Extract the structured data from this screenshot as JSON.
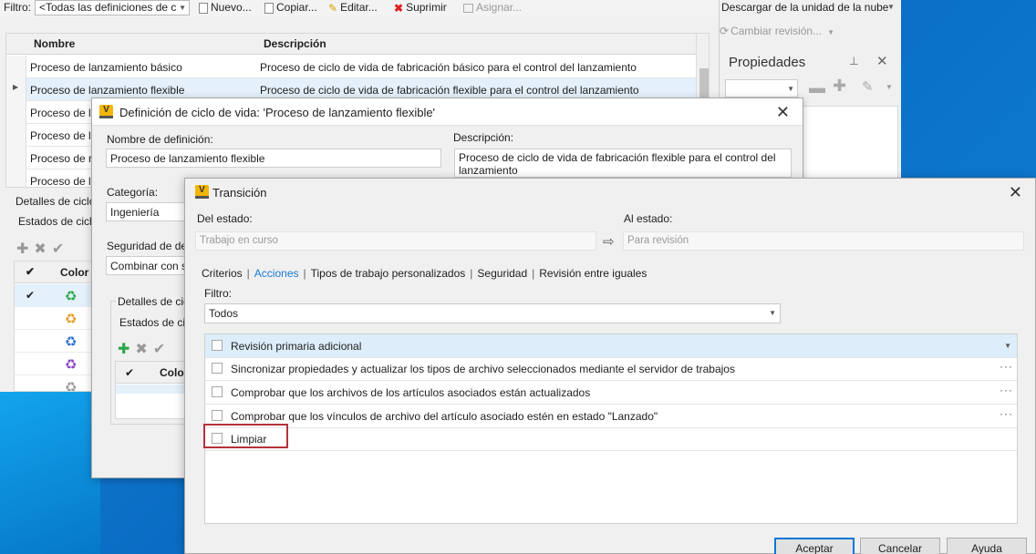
{
  "toolbar": {
    "filter_label": "Filtro:",
    "filter_value": "<Todas las definiciones de c",
    "new_label": "Nuevo...",
    "copy_label": "Copiar...",
    "edit_label": "Editar...",
    "delete_label": "Suprimir",
    "assign_label": "Asignar..."
  },
  "lifecycle_grid": {
    "columns": [
      "Nombre",
      "Descripción"
    ],
    "rows": [
      {
        "name": "Proceso de lanzamiento básico",
        "desc": "Proceso de ciclo de vida de fabricación básico para el control del lanzamiento"
      },
      {
        "name": "Proceso de lanzamiento flexible",
        "desc": "Proceso de ciclo de vida de fabricación flexible para el control del lanzamiento"
      },
      {
        "name": "Proceso de la",
        "desc": ""
      },
      {
        "name": "Proceso de la",
        "desc": ""
      },
      {
        "name": "Proceso de re",
        "desc": ""
      },
      {
        "name": "Proceso de la",
        "desc": ""
      }
    ]
  },
  "details": {
    "label": "Detalles de ciclo",
    "states_label": "Estados de ciclo",
    "col_color": "Color"
  },
  "right_panel": {
    "download_label": "Descargar de la unidad de la nube",
    "change_revision_label": "Cambiar revisión...",
    "properties_title": "Propiedades"
  },
  "dialog_lifecycle": {
    "title": "Definición de ciclo de vida: 'Proceso de lanzamiento flexible'",
    "name_label": "Nombre de definición:",
    "name_value": "Proceso de lanzamiento flexible",
    "desc_label": "Descripción:",
    "desc_value": "Proceso de ciclo de vida de fabricación flexible para el control del lanzamiento",
    "category_label": "Categoría:",
    "category_value": "Ingeniería",
    "security_label": "Seguridad de de",
    "security_value": "Combinar con s",
    "details_label": "Detalles de cic",
    "states_label": "Estados de cic",
    "col_color": "Color"
  },
  "dialog_transition": {
    "title": "Transición",
    "from_label": "Del estado:",
    "from_value": "Trabajo en curso",
    "to_label": "Al estado:",
    "to_value": "Para revisión",
    "tabs": [
      "Criterios",
      "Acciones",
      "Tipos de trabajo personalizados",
      "Seguridad",
      "Revisión entre iguales"
    ],
    "filter_label": "Filtro:",
    "filter_value": "Todos",
    "actions": [
      "Revisión primaria adicional",
      "Sincronizar propiedades y actualizar los tipos de archivo seleccionados mediante el servidor de trabajos",
      "Comprobar que los archivos de los artículos asociados están actualizados",
      "Comprobar que los vínculos de archivo del artículo asociado estén en estado \"Lanzado\"",
      "Limpiar"
    ],
    "buttons": {
      "ok": "Aceptar",
      "cancel": "Cancelar",
      "help": "Ayuda"
    }
  },
  "colors": {
    "accent": "#1a7bd3",
    "highlight_border": "#b3333a",
    "selection": "#ddeefa",
    "logo": "#f2b705"
  }
}
